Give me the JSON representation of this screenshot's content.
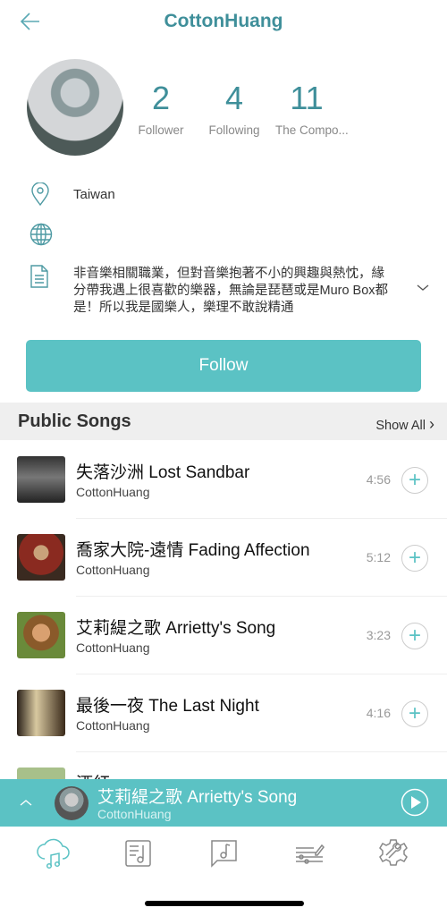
{
  "header": {
    "title": "CottonHuang",
    "back_icon": "arrow-left-icon"
  },
  "profile": {
    "stats": [
      {
        "value": "2",
        "label": "Follower"
      },
      {
        "value": "4",
        "label": "Following"
      },
      {
        "value": "11",
        "label": "The Compo..."
      }
    ],
    "location": "Taiwan",
    "website": "",
    "bio": "非音樂相關職業，但對音樂抱著不小的興趣與熱忱，緣分帶我遇上很喜歡的樂器，無論是琵琶或是Muro Box都是！所以我是國樂人，樂理不敢說精通",
    "follow_label": "Follow"
  },
  "public_songs": {
    "heading": "Public Songs",
    "show_all": "Show All",
    "songs": [
      {
        "title": "失落沙洲 Lost Sandbar",
        "artist": "CottonHuang",
        "duration": "4:56"
      },
      {
        "title": "喬家大院-遠情 Fading Affection",
        "artist": "CottonHuang",
        "duration": "5:12"
      },
      {
        "title": "艾莉緹之歌 Arrietty's Song",
        "artist": "CottonHuang",
        "duration": "3:23"
      },
      {
        "title": "最後一夜 The Last Night",
        "artist": "CottonHuang",
        "duration": "4:16"
      },
      {
        "title": "酒紅",
        "artist": "",
        "duration": ""
      }
    ]
  },
  "now_playing": {
    "title": "艾莉緹之歌 Arrietty's Song",
    "artist": "CottonHuang"
  },
  "tabs": [
    "cloud-music-icon",
    "music-sheet-icon",
    "music-message-icon",
    "composer-edit-icon",
    "settings-tools-icon"
  ],
  "colors": {
    "accent": "#5bc2c4",
    "title": "#3f8f9a"
  }
}
